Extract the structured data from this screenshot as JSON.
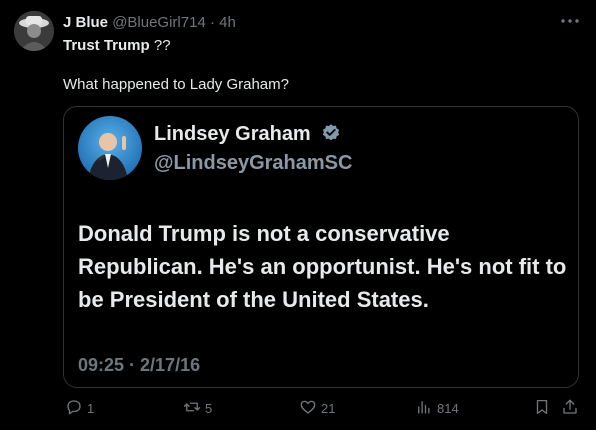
{
  "author": {
    "name": "J Blue",
    "handle": "@BlueGirl714",
    "separator": "·",
    "time": "4h"
  },
  "post": {
    "line1_bold": "Trust Trump",
    "line1_rest": " ??",
    "line2": "What happened to Lady Graham?"
  },
  "quote": {
    "name": "Lindsey Graham",
    "handle": "@LindseyGrahamSC",
    "text": "Donald Trump is not a conservative Republican. He's an opportunist. He's not fit to be President of the United States.",
    "timestamp": "09:25 · 2/17/16"
  },
  "actions": {
    "replies": "1",
    "reposts": "5",
    "likes": "21",
    "views": "814"
  },
  "icons": [
    "more-icon",
    "verified-icon",
    "reply-icon",
    "repost-icon",
    "like-icon",
    "views-icon",
    "bookmark-icon",
    "share-icon"
  ],
  "colors": {
    "background": "#000000",
    "text": "#e7e9ea",
    "muted": "#71767b",
    "verified": "#829aab",
    "border": "#2f3336"
  }
}
